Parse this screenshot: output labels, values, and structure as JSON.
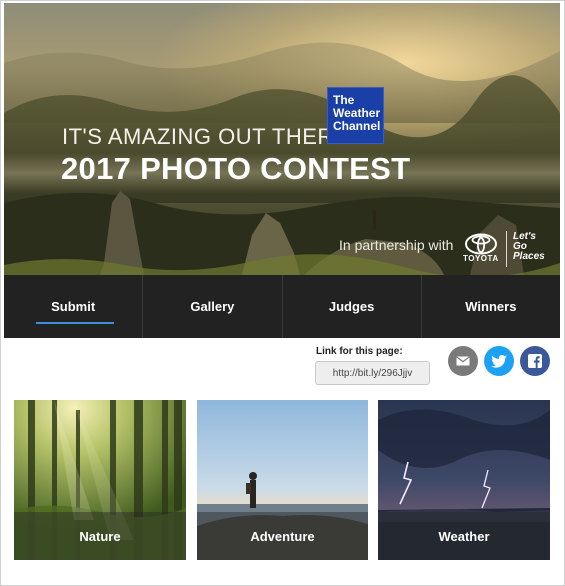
{
  "hero": {
    "tagline": "IT'S AMAZING OUT THERE",
    "title": "2017 PHOTO CONTEST",
    "sponsor_logo": {
      "lines": [
        "The",
        "Weather",
        "Channel"
      ],
      "color": "#1a3fa6"
    },
    "partnership_text": "In partnership with",
    "partner": {
      "name": "TOYOTA",
      "slogan": [
        "Let's",
        "Go",
        "Places"
      ]
    }
  },
  "nav": {
    "tabs": [
      {
        "label": "Submit",
        "active": true
      },
      {
        "label": "Gallery",
        "active": false
      },
      {
        "label": "Judges",
        "active": false
      },
      {
        "label": "Winners",
        "active": false
      }
    ],
    "accent": "#3e8ed8"
  },
  "share": {
    "label": "Link for this page:",
    "link": "http://bit.ly/296Jjjv",
    "buttons": [
      {
        "icon": "email-icon",
        "color": "#7a7a7a"
      },
      {
        "icon": "twitter-icon",
        "color": "#1da1f2"
      },
      {
        "icon": "facebook-icon",
        "color": "#3b5998"
      }
    ]
  },
  "categories": [
    {
      "label": "Nature"
    },
    {
      "label": "Adventure"
    },
    {
      "label": "Weather"
    }
  ]
}
